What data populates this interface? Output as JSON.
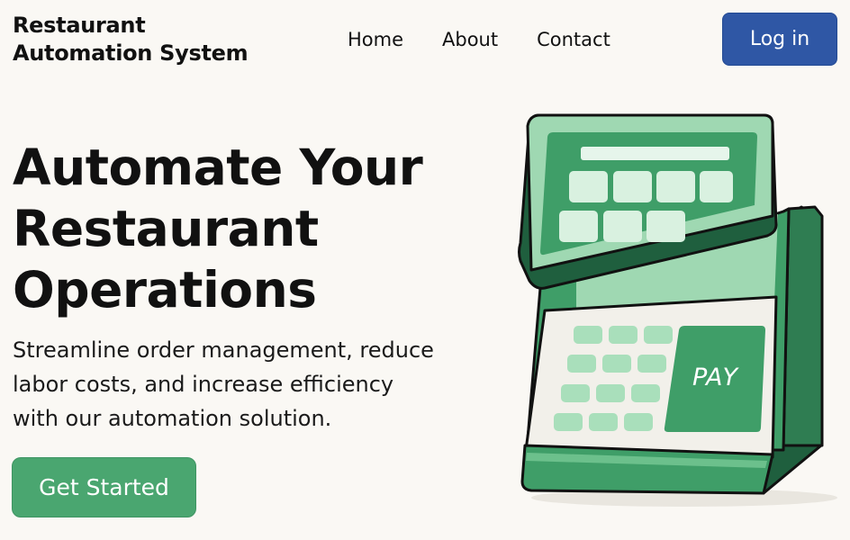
{
  "header": {
    "logo_line1": "Restaurant",
    "logo_line2": "Automation System",
    "nav": [
      {
        "label": "Home"
      },
      {
        "label": "About"
      },
      {
        "label": "Contact"
      }
    ],
    "login_label": "Log in"
  },
  "hero": {
    "title_line1": "Automate Your",
    "title_line2": "Restaurant",
    "title_line3": "Operations",
    "subtitle_line1": "Streamline order management, reduce",
    "subtitle_line2": "labor costs, and increase efficiency",
    "subtitle_line3": "with our automation solution.",
    "cta_label": "Get Started"
  },
  "illustration": {
    "pay_label": "PAY",
    "icon": "pos-terminal-icon"
  },
  "colors": {
    "background": "#faf8f4",
    "login_button": "#2f57a5",
    "cta_button": "#4aa670",
    "terminal_green": "#3f9e68",
    "terminal_dark": "#1f5f3e",
    "terminal_light": "#b8e6c6"
  }
}
